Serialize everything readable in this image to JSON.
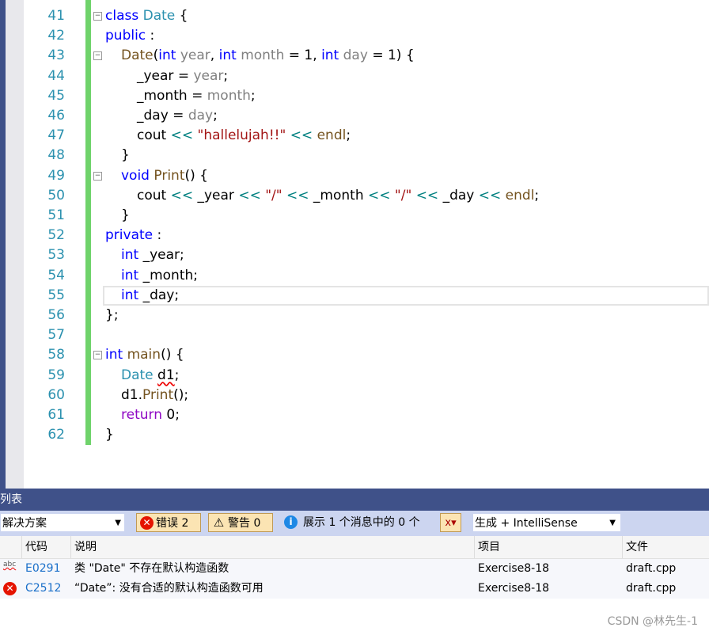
{
  "editor": {
    "lines": [
      {
        "n": "41",
        "fold": true,
        "indent": 0,
        "t": [
          [
            "class ",
            "kw"
          ],
          [
            "Date",
            "ty"
          ],
          [
            " {",
            "pl"
          ]
        ]
      },
      {
        "n": "42",
        "indent": 0,
        "t": [
          [
            "public",
            "kw"
          ],
          [
            " :",
            "pl"
          ]
        ]
      },
      {
        "n": "43",
        "fold": true,
        "indent": 1,
        "t": [
          [
            "Date",
            "fn"
          ],
          [
            "(",
            "pl"
          ],
          [
            "int ",
            "kw"
          ],
          [
            "year",
            "pm"
          ],
          [
            ", ",
            "pl"
          ],
          [
            "int ",
            "kw"
          ],
          [
            "month",
            "pm"
          ],
          [
            " = 1, ",
            "pl"
          ],
          [
            "int ",
            "kw"
          ],
          [
            "day",
            "pm"
          ],
          [
            " = 1) {",
            "pl"
          ]
        ]
      },
      {
        "n": "44",
        "indent": 2,
        "t": [
          [
            "_year = ",
            "pl"
          ],
          [
            "year",
            "pm"
          ],
          [
            ";",
            "pl"
          ]
        ]
      },
      {
        "n": "45",
        "indent": 2,
        "t": [
          [
            "_month = ",
            "pl"
          ],
          [
            "month",
            "pm"
          ],
          [
            ";",
            "pl"
          ]
        ]
      },
      {
        "n": "46",
        "indent": 2,
        "t": [
          [
            "_day = ",
            "pl"
          ],
          [
            "day",
            "pm"
          ],
          [
            ";",
            "pl"
          ]
        ]
      },
      {
        "n": "47",
        "indent": 2,
        "t": [
          [
            "cout ",
            "pl"
          ],
          [
            "<<",
            "op"
          ],
          [
            " ",
            "pl"
          ],
          [
            "\"hallelujah!!\"",
            "st"
          ],
          [
            " ",
            "pl"
          ],
          [
            "<<",
            "op"
          ],
          [
            " ",
            "pl"
          ],
          [
            "endl",
            "fn"
          ],
          [
            ";",
            "pl"
          ]
        ]
      },
      {
        "n": "48",
        "indent": 1,
        "t": [
          [
            "}",
            "pl"
          ]
        ]
      },
      {
        "n": "49",
        "fold": true,
        "indent": 1,
        "t": [
          [
            "void ",
            "kw"
          ],
          [
            "Print",
            "fn"
          ],
          [
            "() {",
            "pl"
          ]
        ]
      },
      {
        "n": "50",
        "indent": 2,
        "t": [
          [
            "cout ",
            "pl"
          ],
          [
            "<<",
            "op"
          ],
          [
            " _year ",
            "pl"
          ],
          [
            "<<",
            "op"
          ],
          [
            " ",
            "pl"
          ],
          [
            "\"/\"",
            "st"
          ],
          [
            " ",
            "pl"
          ],
          [
            "<<",
            "op"
          ],
          [
            " _month ",
            "pl"
          ],
          [
            "<<",
            "op"
          ],
          [
            " ",
            "pl"
          ],
          [
            "\"/\"",
            "st"
          ],
          [
            " ",
            "pl"
          ],
          [
            "<<",
            "op"
          ],
          [
            " _day ",
            "pl"
          ],
          [
            "<<",
            "op"
          ],
          [
            " ",
            "pl"
          ],
          [
            "endl",
            "fn"
          ],
          [
            ";",
            "pl"
          ]
        ]
      },
      {
        "n": "51",
        "indent": 1,
        "t": [
          [
            "}",
            "pl"
          ]
        ]
      },
      {
        "n": "52",
        "indent": 0,
        "t": [
          [
            "private",
            "kw"
          ],
          [
            " :",
            "pl"
          ]
        ]
      },
      {
        "n": "53",
        "indent": 1,
        "t": [
          [
            "int ",
            "kw"
          ],
          [
            "_year;",
            "pl"
          ]
        ]
      },
      {
        "n": "54",
        "indent": 1,
        "t": [
          [
            "int ",
            "kw"
          ],
          [
            "_month;",
            "pl"
          ]
        ]
      },
      {
        "n": "55",
        "indent": 1,
        "current": true,
        "t": [
          [
            "int ",
            "kw"
          ],
          [
            "_day;",
            "pl"
          ]
        ]
      },
      {
        "n": "56",
        "indent": 0,
        "t": [
          [
            "};",
            "pl"
          ]
        ]
      },
      {
        "n": "57",
        "indent": 0,
        "t": []
      },
      {
        "n": "58",
        "fold": true,
        "indent": 0,
        "t": [
          [
            "int ",
            "kw"
          ],
          [
            "main",
            "fn"
          ],
          [
            "() {",
            "pl"
          ]
        ]
      },
      {
        "n": "59",
        "indent": 1,
        "t": [
          [
            "Date ",
            "ty"
          ],
          [
            "d1",
            "sq"
          ],
          [
            ";",
            "pl"
          ]
        ]
      },
      {
        "n": "60",
        "indent": 1,
        "t": [
          [
            "d1.",
            "pl"
          ],
          [
            "Print",
            "fn"
          ],
          [
            "();",
            "pl"
          ]
        ]
      },
      {
        "n": "61",
        "indent": 1,
        "t": [
          [
            "return ",
            "pu"
          ],
          [
            "0;",
            "pl"
          ]
        ]
      },
      {
        "n": "62",
        "indent": 0,
        "t": [
          [
            "}",
            "pl"
          ]
        ]
      }
    ]
  },
  "panel": {
    "title": "列表",
    "scope": "解决方案",
    "errors_label": "错误 2",
    "warnings_label": "警告 0",
    "messages_label": "展示 1 个消息中的 0 个",
    "source": "生成 + IntelliSense",
    "columns": {
      "code": "代码",
      "desc": "说明",
      "project": "项目",
      "file": "文件"
    },
    "rows": [
      {
        "icon": "intellisense-squiggle-icon",
        "code": "E0291",
        "desc": "类 \"Date\" 不存在默认构造函数",
        "project": "Exercise8-18",
        "file": "draft.cpp"
      },
      {
        "icon": "error-icon",
        "code": "C2512",
        "desc": "“Date”: 没有合适的默认构造函数可用",
        "project": "Exercise8-18",
        "file": "draft.cpp"
      }
    ]
  },
  "watermark": "CSDN @林先生-1",
  "colors": {
    "accent": "#3f5189",
    "keyword": "#0000ff",
    "type": "#2b91af",
    "error": "#e51400"
  }
}
